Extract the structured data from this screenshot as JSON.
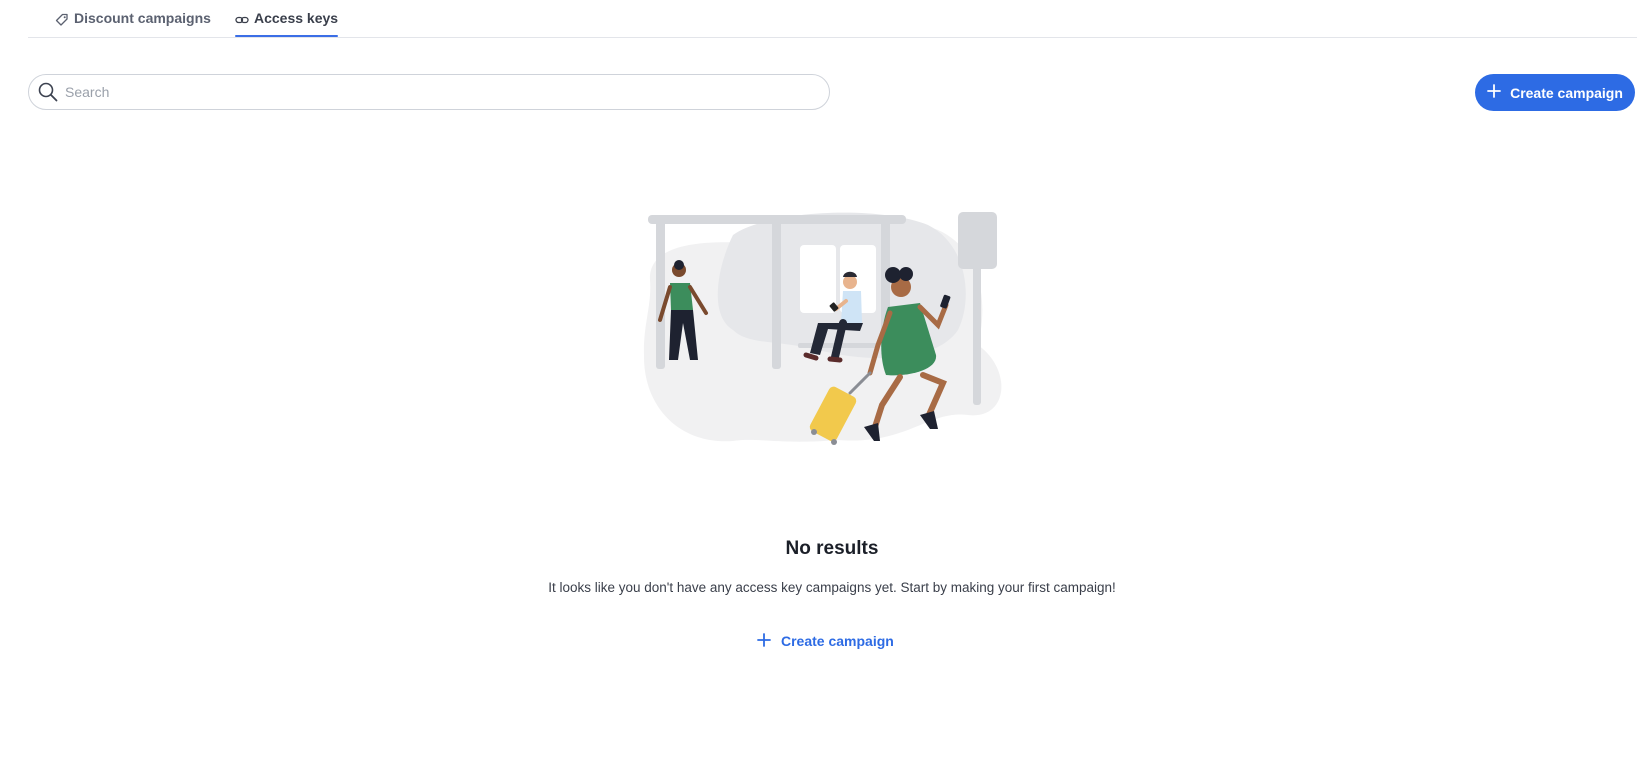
{
  "tabs": [
    {
      "label": "Discount campaigns",
      "icon": "tag-icon",
      "active": false
    },
    {
      "label": "Access keys",
      "icon": "link-icon",
      "active": true
    }
  ],
  "search": {
    "placeholder": "Search",
    "value": ""
  },
  "header": {
    "create_label": "Create campaign"
  },
  "empty_state": {
    "title": "No results",
    "message": "It looks like you don't have any access key campaigns yet. Start by making your first campaign!",
    "action_label": "Create campaign"
  },
  "colors": {
    "accent": "#2d6be4",
    "text": "#1b1f28",
    "muted": "#5b6170"
  }
}
